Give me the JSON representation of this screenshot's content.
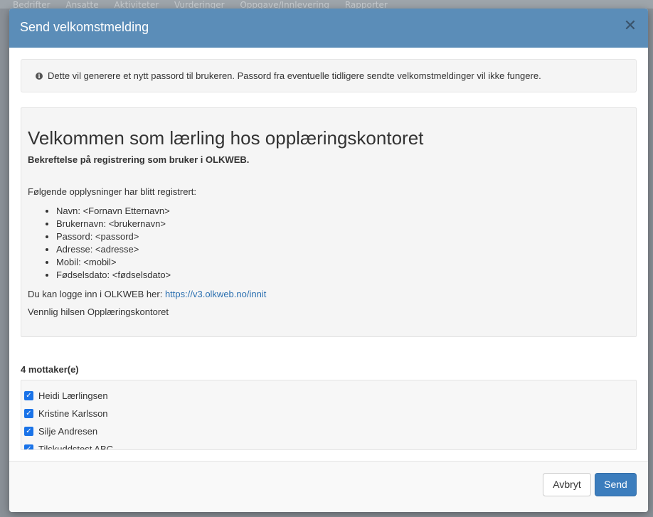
{
  "background": {
    "nav_items": [
      "Bedrifter",
      "Ansatte",
      "Aktiviteter",
      "Vurderinger",
      "Oppgave/Innlevering",
      "Rapporter"
    ]
  },
  "modal": {
    "title": "Send velkomstmelding",
    "close_icon": "close-icon",
    "info": {
      "icon": "info-icon",
      "text": "Dette vil generere et nytt passord til brukeren. Passord fra eventuelle tidligere sendte velkomstmeldinger vil ikke fungere."
    },
    "preview": {
      "heading": "Velkommen som lærling hos opplæringskontoret",
      "subtitle": "Bekreftelse på registrering som bruker i OLKWEB.",
      "intro": "Følgende opplysninger har blitt registrert:",
      "fields": [
        "Navn: <Fornavn Etternavn>",
        "Brukernavn: <brukernavn>",
        "Passord: <passord>",
        "Adresse: <adresse>",
        "Mobil: <mobil>",
        "Fødselsdato: <fødselsdato>"
      ],
      "login_text": "Du kan logge inn i OLKWEB her:",
      "login_link": "https://v3.olkweb.no/innit",
      "signature": "Vennlig hilsen Opplæringskontoret"
    },
    "recipients": {
      "label": "4 mottaker(e)",
      "items": [
        {
          "name": "Heidi Lærlingsen",
          "checked": true
        },
        {
          "name": "Kristine Karlsson",
          "checked": true
        },
        {
          "name": "Silje Andresen",
          "checked": true
        },
        {
          "name": "Tilskuddstest ABC",
          "checked": true
        }
      ]
    },
    "footer": {
      "cancel_label": "Avbryt",
      "send_label": "Send"
    }
  },
  "colors": {
    "header": "#5b8db8",
    "send_button": "#3c7dbd",
    "checkbox": "#1a73e8",
    "link": "#2a6fb0"
  }
}
